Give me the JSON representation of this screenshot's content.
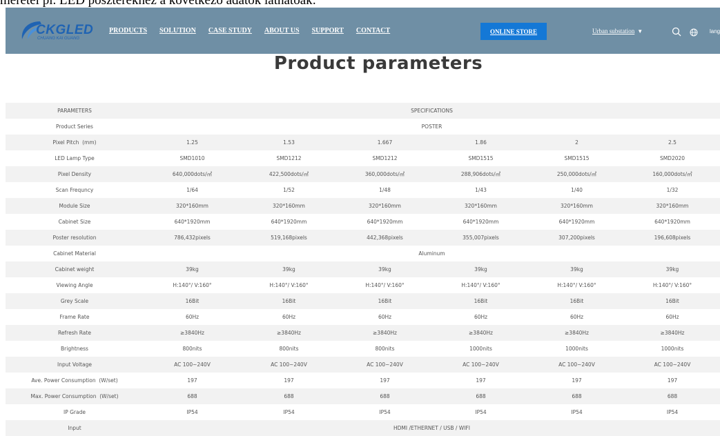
{
  "caption": "méretei pl. LED poszterekhez a következő adatok láthatóak:",
  "logo": {
    "name": "CKGLED",
    "subtitle": "CHUANG KAI GUANG"
  },
  "nav": {
    "items": [
      "PRODUCTS",
      "SOLUTION",
      "CASE STUDY",
      "ABOUT US",
      "SUPPORT",
      "CONTACT"
    ],
    "store_button": "ONLINE STORE",
    "dropdown": "Urban substation",
    "lang": "lang"
  },
  "page_title": "Product parameters",
  "table": {
    "rows": [
      {
        "label": "PARAMETERS",
        "span": "SPECIFICATIONS"
      },
      {
        "label": "Product Series",
        "span": "POSTER"
      },
      {
        "label": "Pixel Pitch  (mm)",
        "values": [
          "1.25",
          "1.53",
          "1.667",
          "1.86",
          "2",
          "2.5"
        ]
      },
      {
        "label": "LED Lamp Type",
        "values": [
          "SMD1010",
          "SMD1212",
          "SMD1212",
          "SMD1515",
          "SMD1515",
          "SMD2020"
        ]
      },
      {
        "label": "Pixel Density",
        "values": [
          "640,000dots/㎡",
          "422,500dots/㎡",
          "360,000dots/㎡",
          "288,906dots/㎡",
          "250,000dots/㎡",
          "160,000dots/㎡"
        ]
      },
      {
        "label": "Scan Frequncy",
        "values": [
          "1/64",
          "1/52",
          "1/48",
          "1/43",
          "1/40",
          "1/32"
        ]
      },
      {
        "label": "Module Size",
        "values": [
          "320*160mm",
          "320*160mm",
          "320*160mm",
          "320*160mm",
          "320*160mm",
          "320*160mm"
        ]
      },
      {
        "label": "Cabinet Size",
        "values": [
          "640*1920mm",
          "640*1920mm",
          "640*1920mm",
          "640*1920mm",
          "640*1920mm",
          "640*1920mm"
        ]
      },
      {
        "label": "Poster resolution",
        "values": [
          "786,432pixels",
          "519,168pixels",
          "442,368pixels",
          "355,007pixels",
          "307,200pixels",
          "196,608pixels"
        ]
      },
      {
        "label": "Cabinet Material",
        "span": "Aluminum"
      },
      {
        "label": "Cabinet weight",
        "values": [
          "39kg",
          "39kg",
          "39kg",
          "39kg",
          "39kg",
          "39kg"
        ]
      },
      {
        "label": "Viewing Angle",
        "values": [
          "H:140°/ V:160°",
          "H:140°/ V:160°",
          "H:140°/ V:160°",
          "H:140°/ V:160°",
          "H:140°/ V:160°",
          "H:140°/ V:160°"
        ]
      },
      {
        "label": "Grey Scale",
        "values": [
          "16Bit",
          "16Bit",
          "16Bit",
          "16Bit",
          "16Bit",
          "16Bit"
        ]
      },
      {
        "label": "Frame Rate",
        "values": [
          "60Hz",
          "60Hz",
          "60Hz",
          "60Hz",
          "60Hz",
          "60Hz"
        ]
      },
      {
        "label": "Refresh Rate",
        "values": [
          "≥3840Hz",
          "≥3840Hz",
          "≥3840Hz",
          "≥3840Hz",
          "≥3840Hz",
          "≥3840Hz"
        ]
      },
      {
        "label": "Brightness",
        "values": [
          "800nits",
          "800nits",
          "800nits",
          "1000nits",
          "1000nits",
          "1000nits"
        ]
      },
      {
        "label": "Input Voltage",
        "values": [
          "AC 100~240V",
          "AC 100~240V",
          "AC 100~240V",
          "AC 100~240V",
          "AC 100~240V",
          "AC 100~240V"
        ]
      },
      {
        "label": "Ave. Power Consumption  (W/set)",
        "values": [
          "197",
          "197",
          "197",
          "197",
          "197",
          "197"
        ]
      },
      {
        "label": "Max. Power Consumption  (W/set)",
        "values": [
          "688",
          "688",
          "688",
          "688",
          "688",
          "688"
        ]
      },
      {
        "label": "IP Grade",
        "values": [
          "IP54",
          "IP54",
          "IP54",
          "IP54",
          "IP54",
          "IP54"
        ]
      },
      {
        "label": "Input",
        "span": "HDMI /ETHERNET / USB / WIFI"
      }
    ]
  }
}
